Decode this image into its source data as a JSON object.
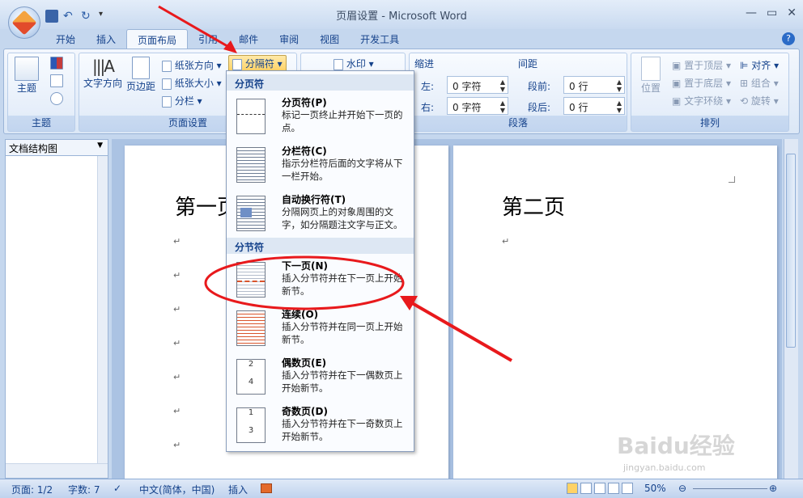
{
  "window": {
    "title": "页眉设置 - Microsoft Word"
  },
  "tabs": [
    "开始",
    "插入",
    "页面布局",
    "引用",
    "邮件",
    "审阅",
    "视图",
    "开发工具"
  ],
  "active_tab": "页面布局",
  "ribbon": {
    "theme": {
      "label": "主题",
      "group_label": "主题"
    },
    "page_setup": {
      "text_direction": "文字方向",
      "margins": "页边距",
      "orientation": "纸张方向",
      "size": "纸张大小",
      "columns": "分栏",
      "breaks": "分隔符",
      "group_label": "页面设置"
    },
    "background": {
      "watermark": "水印"
    },
    "paragraph": {
      "indent": "缩进",
      "spacing": "间距",
      "left_label": "左:",
      "left_value": "0 字符",
      "right_label": "右:",
      "right_value": "0 字符",
      "before_label": "段前:",
      "before_value": "0 行",
      "after_label": "段后:",
      "after_value": "0 行",
      "group_label": "段落"
    },
    "arrange": {
      "position": "位置",
      "bring_front": "置于顶层",
      "send_back": "置于底层",
      "text_wrap": "文字环绕",
      "align": "对齐",
      "group": "组合",
      "rotate": "旋转",
      "group_label": "排列"
    }
  },
  "left_pane": {
    "title": "文档结构图"
  },
  "document": {
    "page1_title": "第一页",
    "page2_title": "第二页"
  },
  "menu": {
    "section1": "分页符",
    "section2": "分节符",
    "items": [
      {
        "title": "分页符(P)",
        "desc": "标记一页终止并开始下一页的点。"
      },
      {
        "title": "分栏符(C)",
        "desc": "指示分栏符后面的文字将从下一栏开始。"
      },
      {
        "title": "自动换行符(T)",
        "desc": "分隔网页上的对象周围的文字，如分隔题注文字与正文。"
      },
      {
        "title": "下一页(N)",
        "desc": "插入分节符并在下一页上开始新节。"
      },
      {
        "title": "连续(O)",
        "desc": "插入分节符并在同一页上开始新节。"
      },
      {
        "title": "偶数页(E)",
        "desc": "插入分节符并在下一偶数页上开始新节。"
      },
      {
        "title": "奇数页(D)",
        "desc": "插入分节符并在下一奇数页上开始新节。"
      }
    ]
  },
  "status": {
    "page": "页面: 1/2",
    "words": "字数: 7",
    "language": "中文(简体，中国)",
    "mode": "插入",
    "zoom": "50%"
  },
  "watermark_text": {
    "brand": "Baidu经验",
    "url": "jingyan.baidu.com"
  },
  "colors": {
    "accent_red": "#e8191c",
    "ribbon_blue": "#15428b"
  }
}
